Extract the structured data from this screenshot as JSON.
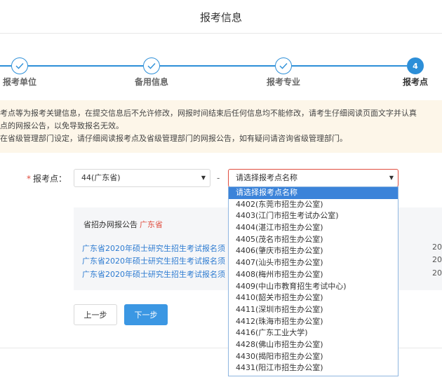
{
  "page_title": "报考信息",
  "steps": [
    {
      "label": "报考单位",
      "state": "done"
    },
    {
      "label": "备用信息",
      "state": "done"
    },
    {
      "label": "报考专业",
      "state": "done"
    },
    {
      "label": "报考点",
      "state": "active",
      "number": "4"
    }
  ],
  "notice_lines": [
    "报考点等为报考关键信息，在提交信息后不允许修改，网报时间结束后任何信息均不能修改，请考生仔细阅读页面文字并认真",
    "考点的网报公告，以免导致报名无效。",
    "所在省级管理部门设定，请仔细阅读报考点及省级管理部门的网报公告，如有疑问请咨询省级管理部门。"
  ],
  "form": {
    "required_mark": "*",
    "label": "报考点：",
    "province_value": "44(广东省)",
    "separator": "-",
    "site_value": "请选择报考点名称"
  },
  "announcement": {
    "heading": "省招办网报公告",
    "province": "广东省",
    "links": [
      {
        "text": "广东省2020年硕士研究生招生考试报名须",
        "date": "20"
      },
      {
        "text": "广东省2020年硕士研究生招生考试报名须",
        "date": "20"
      },
      {
        "text": "广东省2020年硕士研究生招生考试报名须",
        "date": "20"
      }
    ]
  },
  "buttons": {
    "prev": "上一步",
    "next": "下一步"
  },
  "dropdown": {
    "selected_index": 0,
    "options": [
      "请选择报考点名称",
      "4402(东莞市招生办公室)",
      "4403(江门市招生考试办公室)",
      "4404(湛江市招生办公室)",
      "4405(茂名市招生办公室)",
      "4406(肇庆市招生办公室)",
      "4407(汕头市招生办公室)",
      "4408(梅州市招生办公室)",
      "4409(中山市教育招生考试中心)",
      "4410(韶关市招生办公室)",
      "4411(深圳市招生办公室)",
      "4412(珠海市招生办公室)",
      "4416(广东工业大学)",
      "4428(佛山市招生办公室)",
      "4430(揭阳市招生办公室)",
      "4431(阳江市招生办公室)"
    ]
  },
  "colors": {
    "accent": "#2d8fd8",
    "link": "#2d7bd1",
    "required": "#e04d3f",
    "notice_bg": "#fdf6e9",
    "selected_option": "#3b83d9"
  }
}
